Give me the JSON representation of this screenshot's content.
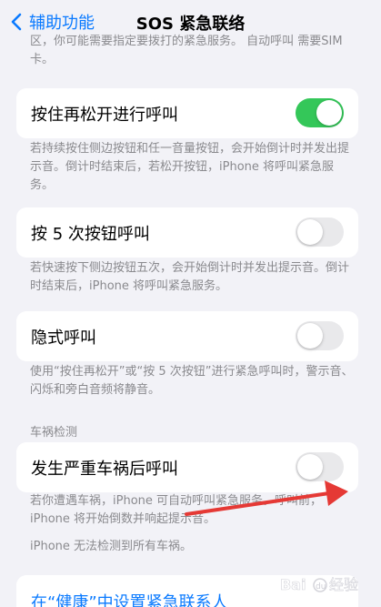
{
  "nav": {
    "back_label": "辅助功能",
    "title": "SOS 紧急联络"
  },
  "intro_text": "区，你可能需要指定要拨打的紧急服务。 自动呼叫 需要SIM卡。",
  "settings": [
    {
      "label": "按住再松开进行呼叫",
      "on": true,
      "description": "若持续按住侧边按钮和任一音量按钮，会开始倒计时并发出提示音。倒计时结束后，若松开按钮，iPhone 将呼叫紧急服务。"
    },
    {
      "label": "按 5 次按钮呼叫",
      "on": false,
      "description": "若快速按下侧边按钮五次，会开始倒计时并发出提示音。倒计时结束后，iPhone 将呼叫紧急服务。"
    },
    {
      "label": "隐式呼叫",
      "on": false,
      "description": "使用“按住再松开”或“按 5 次按钮”进行紧急呼叫时，警示音、闪烁和旁白音频将静音。"
    }
  ],
  "crash_section": {
    "header": "车祸检测",
    "label": "发生严重车祸后呼叫",
    "on": false,
    "description": "若你遭遇车祸，iPhone 可自动呼叫紧急服务。呼叫前，iPhone 将开始倒数并响起提示音。",
    "note": "iPhone 无法检测到所有车祸。"
  },
  "health_link": {
    "label": "在“健康”中设置紧急联系人"
  },
  "annotation": {
    "arrow_color": "#e53935"
  },
  "watermark": {
    "text": "Baidu 经验",
    "color": "#ffffff"
  },
  "colors": {
    "accent": "#0a7aff",
    "toggle_on": "#34c759",
    "background": "#f2f2f7"
  }
}
